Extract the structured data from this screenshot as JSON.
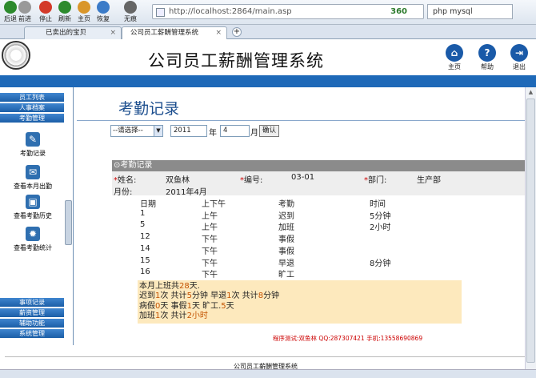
{
  "browser": {
    "buttons": [
      {
        "label": "后退",
        "icon": "back-icon",
        "color": "#2d8a2d"
      },
      {
        "label": "前进",
        "icon": "forward-icon",
        "color": "#999999"
      },
      {
        "label": "停止",
        "icon": "stop-icon",
        "color": "#d33a2a"
      },
      {
        "label": "刷新",
        "icon": "refresh-icon",
        "color": "#2d8a2d"
      },
      {
        "label": "主页",
        "icon": "home-icon",
        "color": "#d9962b"
      },
      {
        "label": "恢复",
        "icon": "restore-icon",
        "color": "#3b7bc8"
      },
      {
        "label": "无痕",
        "icon": "incognito-icon",
        "color": "#666666"
      }
    ],
    "url": "http://localhost:2864/main.asp",
    "brand": "360",
    "search_text": "php mysql",
    "tabs": [
      {
        "label": "已卖出的宝贝"
      },
      {
        "label": "公司员工薪酬管理系统"
      }
    ]
  },
  "app": {
    "title": "公司员工薪酬管理系统",
    "header_buttons": [
      {
        "label": "主页",
        "icon": "home-icon",
        "glyph": "⌂",
        "color": "#1a5aa8"
      },
      {
        "label": "帮助",
        "icon": "help-icon",
        "glyph": "?",
        "color": "#1a5aa8"
      },
      {
        "label": "退出",
        "icon": "exit-icon",
        "glyph": "⇥",
        "color": "#1a5aa8"
      }
    ]
  },
  "sidebar": {
    "top_menu": [
      "员工列表",
      "人事档案",
      "考勤管理"
    ],
    "items": [
      {
        "label": "考勤记录",
        "icon": "pen-icon"
      },
      {
        "label": "查看本月出勤",
        "icon": "chat-icon"
      },
      {
        "label": "查看考勤历史",
        "icon": "save-icon"
      },
      {
        "label": "查看考勤统计",
        "icon": "gear-icon"
      }
    ],
    "bottom_menu": [
      "事项记录",
      "薪资管理",
      "辅助功能",
      "系统管理"
    ]
  },
  "main": {
    "page_title": "考勤记录",
    "filter": {
      "select_value": "--请选择--",
      "year": "2011",
      "year_unit": "年",
      "month": "4",
      "month_unit": "月",
      "confirm": "确认"
    },
    "record": {
      "bar_title": "考勤记录",
      "bar_icon": "⊙",
      "name_label": "姓名:",
      "name": "双鱼林",
      "id_label": "编号:",
      "id": "03-01",
      "dept_label": "部门:",
      "dept": "生产部",
      "month_label": "月份:",
      "month": "2011年4月"
    },
    "table": {
      "headers": [
        "日期",
        "上下午",
        "考勤",
        "时间"
      ],
      "rows": [
        [
          "1",
          "上午",
          "迟到",
          "5分钟"
        ],
        [
          "5",
          "上午",
          "加班",
          "2小时"
        ],
        [
          "12",
          "下午",
          "事假",
          ""
        ],
        [
          "14",
          "下午",
          "事假",
          ""
        ],
        [
          "15",
          "下午",
          "早退",
          "8分钟"
        ],
        [
          "16",
          "下午",
          "旷工",
          ""
        ]
      ]
    },
    "summary": [
      [
        {
          "t": "本月上班共"
        },
        {
          "t": "28",
          "h": true
        },
        {
          "t": "天."
        }
      ],
      [
        {
          "t": "迟到"
        },
        {
          "t": "1",
          "h": true
        },
        {
          "t": "次  共计"
        },
        {
          "t": "5",
          "h": true
        },
        {
          "t": "分钟  早退"
        },
        {
          "t": "1",
          "h": true
        },
        {
          "t": "次  共计"
        },
        {
          "t": "8",
          "h": true
        },
        {
          "t": "分钟"
        }
      ],
      [
        {
          "t": "病假"
        },
        {
          "t": "0",
          "h": true
        },
        {
          "t": "天  事假"
        },
        {
          "t": "1",
          "h": true
        },
        {
          "t": "天  旷工."
        },
        {
          "t": "5",
          "h": true
        },
        {
          "t": "天"
        }
      ],
      [
        {
          "t": "加班"
        },
        {
          "t": "1",
          "h": true
        },
        {
          "t": "次  共计"
        },
        {
          "t": "2小时",
          "h": true
        }
      ]
    ],
    "credit": "程序测试:双鱼林  QQ:287307421  手机:13558690869",
    "footer": "公司员工薪酬管理系统"
  }
}
